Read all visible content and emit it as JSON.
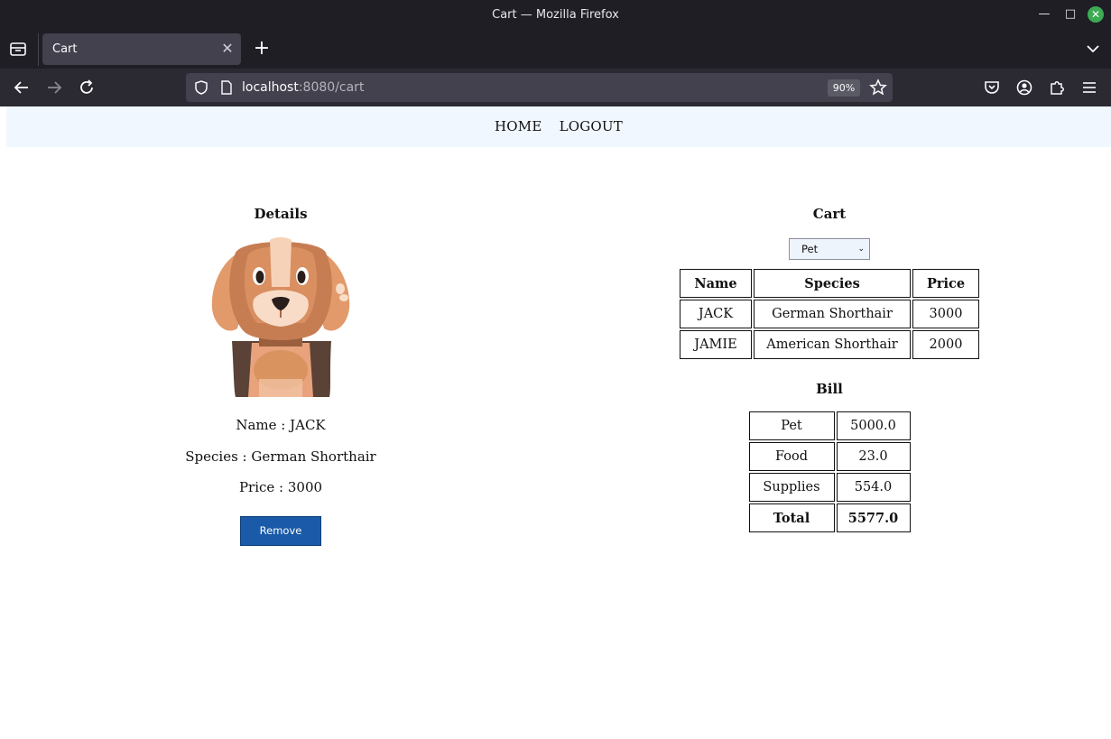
{
  "browser": {
    "window_title": "Cart — Mozilla Firefox",
    "tab_title": "Cart",
    "url_host": "localhost",
    "url_rest": ":8080/cart",
    "zoom": "90%"
  },
  "nav": {
    "home": "HOME",
    "logout": "LOGOUT"
  },
  "details": {
    "title": "Details",
    "name_line": "Name : JACK",
    "species_line": "Species : German Shorthair",
    "price_line": "Price : 3000",
    "remove_label": "Remove"
  },
  "cart": {
    "title": "Cart",
    "filter_selected": "Pet",
    "headers": {
      "name": "Name",
      "species": "Species",
      "price": "Price"
    },
    "rows": [
      {
        "name": "JACK",
        "species": "German Shorthair",
        "price": "3000"
      },
      {
        "name": "JAMIE",
        "species": "American Shorthair",
        "price": "2000"
      }
    ]
  },
  "bill": {
    "title": "Bill",
    "rows": [
      {
        "label": "Pet",
        "value": "5000.0"
      },
      {
        "label": "Food",
        "value": "23.0"
      },
      {
        "label": "Supplies",
        "value": "554.0"
      }
    ],
    "total_label": "Total",
    "total_value": "5577.0"
  },
  "colors": {
    "nav_bg": "#f0f7ff",
    "button": "#1a5aa8"
  }
}
